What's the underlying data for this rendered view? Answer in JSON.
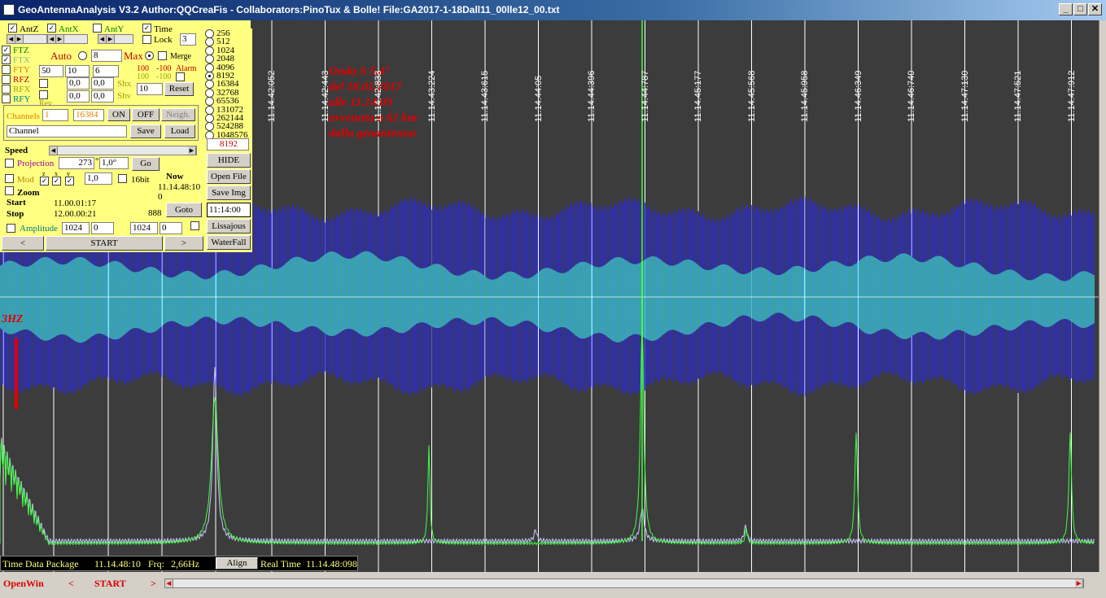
{
  "window": {
    "title": "GeoAntennaAnalysis V3.2 Author:QQCreaFis - Collaborators:PinoTux & Bolle!   File:GA2017-1-18Dall11_00lle12_00.txt",
    "min": "_",
    "max": "□",
    "close": "✕"
  },
  "antennas": {
    "antz": "AntZ",
    "antx": "AntX",
    "anty": "AntY",
    "time": "Time",
    "lock": "Lock",
    "lock_value": "3"
  },
  "filters": {
    "ftz": "FTZ",
    "ftx": "FTX",
    "fty": "FTY",
    "rfz": "RFZ",
    "rfx": "RFX",
    "rfy": "RFY",
    "rev": "Rev",
    "auto": "Auto",
    "max": "Max",
    "merge": "Merge",
    "alarm": "Alarm",
    "auto_value": "8",
    "f1": "50",
    "f2": "10",
    "f3": "6",
    "shx": "Shx",
    "shv": "Shv",
    "shx1": "0,0",
    "shx2": "0,0",
    "shv1": "0,0",
    "shv2": "0,0",
    "alarm_hi": "100",
    "alarm_lo": "-100",
    "alarm_hi2": "100",
    "alarm_lo2": "-100",
    "reset_value": "10",
    "reset": "Reset"
  },
  "channels": {
    "label": "Channels",
    "from": "1",
    "to": "16384",
    "on": "ON",
    "off": "OFF",
    "neigh": "Neigh.",
    "name_value": "Channel",
    "save": "Save",
    "load": "Load"
  },
  "speed": {
    "label": "Speed"
  },
  "projection": {
    "label": "Projection",
    "angle": "273",
    "deg": "°",
    "step": "1,0°",
    "go": "Go"
  },
  "mod": {
    "label": "Mod",
    "z": "z",
    "x": "x",
    "y": "y",
    "factor": "1,0",
    "bit16": "16bit",
    "zoom": "Zoom"
  },
  "times": {
    "now_label": "Now",
    "now_value": "11.14.48:10",
    "now_sub": "0",
    "start_label": "Start",
    "start_value": "11.00.01:17",
    "stop_label": "Stop",
    "stop_value": "12.00.00:21",
    "count": "888",
    "goto": "Goto",
    "goto_time": "11:14:00"
  },
  "amplitude": {
    "label": "Amplitude",
    "a1": "1024",
    "a2": "0",
    "a3": "1024",
    "a4": "0"
  },
  "nav": {
    "prev": "<",
    "start": "START",
    "next": ">"
  },
  "fft_sizes": [
    "256",
    "512",
    "1024",
    "2048",
    "4096",
    "8192",
    "16384",
    "32768",
    "65536",
    "131072",
    "262144",
    "524288",
    "1048576"
  ],
  "fft_selected": "8192",
  "fft_value": "8192",
  "side_buttons": {
    "hide": "HIDE",
    "open": "Open File",
    "saveimg": "Save Img",
    "lissajous": "Lissajous",
    "waterfall": "WaterFall"
  },
  "time_ticks": [
    "11.14.42:052",
    "11.14.42:443",
    "11.14.42:833",
    "11.14.43:224",
    "11.14.43:615",
    "11.14.44:05",
    "11.14.44:396",
    "11.14.44:787",
    "11.14.45:177",
    "11.14.45:568",
    "11.14.45:958",
    "11.14.46:349",
    "11.14.46:740",
    "11.14.47:130",
    "11.14.47:521",
    "11.14.47:912"
  ],
  "annotation": [
    "Onda S 5.4°",
    "del 18.01.2017",
    "alle 11.14.09",
    "avvenuta a 61 km",
    "dalla geoantenna"
  ],
  "marker_label": "3HZ",
  "status": {
    "tdp_label": "Time Data Package",
    "tdp_value": "11.14.48:10",
    "frq_label": "Frq:",
    "frq_value": "2,66Hz",
    "align": "Align",
    "rt_label": "Real Time",
    "rt_value": "11.14.48:098"
  },
  "bottom": {
    "openwin": "OpenWin",
    "prev": "<",
    "start": "START",
    "next": ">"
  },
  "colors": {
    "panel": "#ffff80",
    "plot_bg": "#3c3c3c",
    "blue": "#2a2ae0",
    "cyan": "#40e8c8",
    "green": "#40ff40",
    "lavender": "#c8c8ff",
    "red": "#e00000"
  }
}
